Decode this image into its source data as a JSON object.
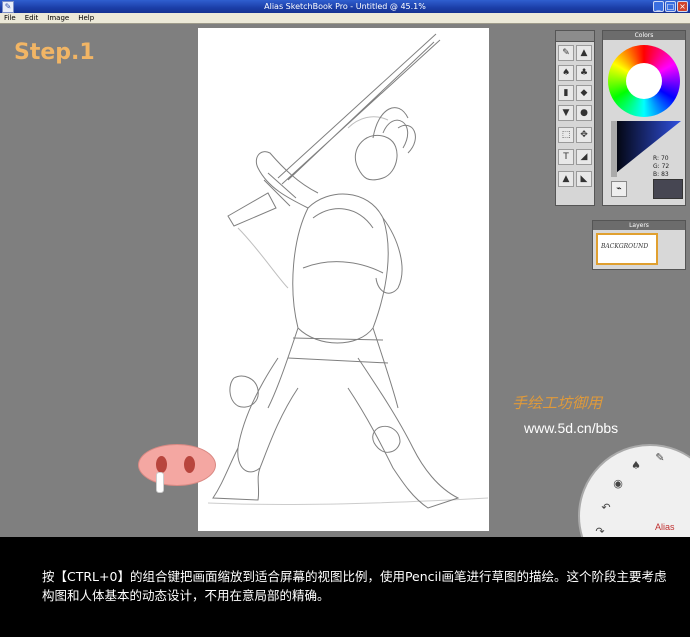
{
  "window": {
    "title": "Alias SketchBook Pro - Untitled @ 45.1%",
    "buttons": [
      "_",
      "□",
      "×"
    ]
  },
  "menu": [
    "File",
    "Edit",
    "Image",
    "Help"
  ],
  "overlay": {
    "step_label": "Step.1",
    "watermark_cn": "手绘工坊御用",
    "url": "www.5d.cn/bbs"
  },
  "colors_panel": {
    "title": "Colors",
    "rgb": {
      "r_label": "R:",
      "r": "70",
      "g_label": "G:",
      "g": "72",
      "b_label": "B:",
      "b": "83"
    },
    "current_color": "#464652"
  },
  "layers_panel": {
    "title": "Layers",
    "layer_name": "BACKGROUND"
  },
  "brand": "Alias",
  "caption": "按【CTRL+0】的组合键把画面缩放到适合屏幕的视图比例，使用Pencil画笔进行草图的描绘。这个阶段主要考虑构图和人体基本的动态设计，不用在意局部的精确。",
  "colors": {
    "accent_orange": "#f1b565",
    "titlebar_blue": "#1b3ea8"
  },
  "tool_icons": [
    "pencil-icon",
    "marker-icon",
    "brush-icon",
    "airbrush-icon",
    "eraser-icon",
    "smudge-icon",
    "fill-icon",
    "ellipse-icon",
    "select-icon",
    "transform-icon",
    "text-icon",
    "ruler-icon"
  ]
}
